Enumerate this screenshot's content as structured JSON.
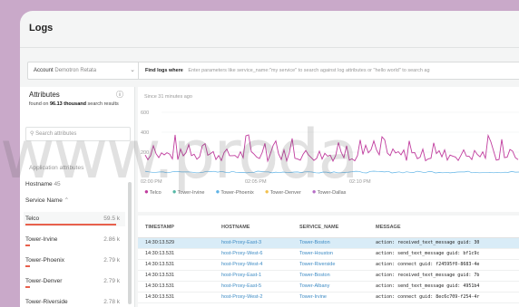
{
  "page": {
    "title": "Logs"
  },
  "account": {
    "label": "Account",
    "value": "Demotron Retata"
  },
  "find_logs": {
    "label": "Find logs where",
    "placeholder": "Enter parameters like service_name:\"my service\" to search against log attributes or \"hello world\" to search ag"
  },
  "sidebar": {
    "title": "Attributes",
    "found_prefix": "found on",
    "found_count": "96.13 thousand",
    "found_suffix": "search results",
    "search_placeholder": "Search attributes",
    "section_label": "Application attributes",
    "hostname_label": "Hostname",
    "hostname_count": "45",
    "service_name_label": "Service Name",
    "services": [
      {
        "name": "Telco",
        "count": "59.5 k",
        "color": "#e8604c",
        "fraction": 1.0
      },
      {
        "name": "Tower-Irvine",
        "count": "2.86 k",
        "color": "#e8604c",
        "fraction": 0.05
      },
      {
        "name": "Tower-Phoenix",
        "count": "2.79 k",
        "color": "#e8604c",
        "fraction": 0.05
      },
      {
        "name": "Tower-Denver",
        "count": "2.79 k",
        "color": "#e8604c",
        "fraction": 0.05
      },
      {
        "name": "Tower-Riverside",
        "count": "2.78 k",
        "color": "#e8604c",
        "fraction": 0.05
      }
    ]
  },
  "chart": {
    "since": "Since 31 minutes ago",
    "y_ticks": [
      "600",
      "400",
      "200"
    ],
    "x_ticks": [
      "02:00 PM",
      "02:05 PM",
      "02:10 PM"
    ],
    "legend": [
      {
        "name": "Telco",
        "color": "#c03c9e"
      },
      {
        "name": "Tower-Irvine",
        "color": "#56b8a6"
      },
      {
        "name": "Tower-Phoenix",
        "color": "#5fb3e6"
      },
      {
        "name": "Tower-Denver",
        "color": "#f2c14e"
      },
      {
        "name": "Tower-Dallas",
        "color": "#b66ec6"
      }
    ]
  },
  "table": {
    "headers": [
      "TIMESTAMP",
      "HOSTNAME",
      "SERVICE_NAME",
      "MESSAGE"
    ],
    "rows": [
      {
        "ts": "14:30:13.529",
        "host": "host-Proxy-East-3",
        "service": "Tower-Boston",
        "msg": "action: received_text_message guid: 30",
        "selected": true
      },
      {
        "ts": "14:30:13.531",
        "host": "host-Proxy-West-6",
        "service": "Tower-Houston",
        "msg": "action: send_text_message guid: bf1c9c"
      },
      {
        "ts": "14:30:13.531",
        "host": "host-Proxy-West-4",
        "service": "Tower-Riverside",
        "msg": "action: connect guid: f24595f0-8683-4e"
      },
      {
        "ts": "14:30:13.531",
        "host": "host-Proxy-East-1",
        "service": "Tower-Boston",
        "msg": "action: received_text_message guid: 7b"
      },
      {
        "ts": "14:30:13.531",
        "host": "host-Proxy-East-5",
        "service": "Tower-Albany",
        "msg": "action: send_text_message guid: 4951b4"
      },
      {
        "ts": "14:30:13.531",
        "host": "host-Proxy-West-2",
        "service": "Tower-Irvine",
        "msg": "action: connect guid: 8ec6c709-f254-4r"
      }
    ]
  },
  "watermark": "www.proda"
}
